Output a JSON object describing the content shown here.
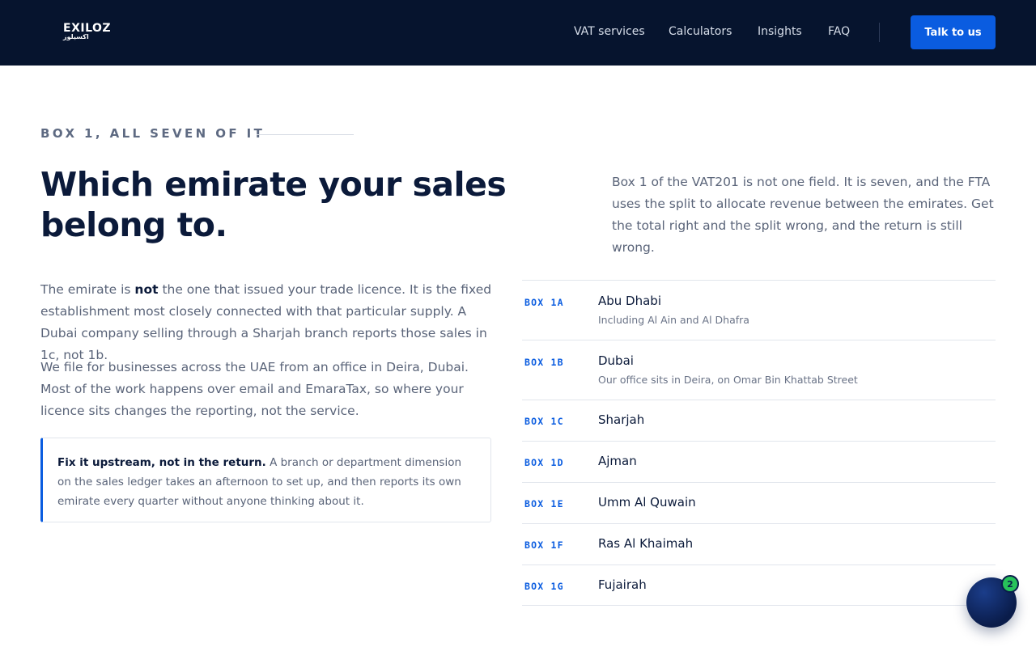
{
  "header": {
    "logo_text": "EXILOZ",
    "logo_arabic": "اكسيلوز",
    "nav": [
      {
        "label": "VAT services"
      },
      {
        "label": "Calculators"
      },
      {
        "label": "Insights"
      },
      {
        "label": "FAQ"
      }
    ],
    "cta_label": "Talk to us"
  },
  "section": {
    "eyebrow": "BOX 1, ALL SEVEN OF IT",
    "heading": "Which emirate your sales belong to.",
    "intro": "Box 1 of the VAT201 is not one field. It is seven, and the FTA uses the split to allocate revenue between the emirates. Get the total right and the split wrong, and the return is still wrong.",
    "para1_before": "The emirate is ",
    "para1_bold": "not",
    "para1_after": " the one that issued your trade licence. It is the fixed establishment most closely connected with that particular supply. A Dubai company selling through a Sharjah branch reports those sales in 1c, not 1b.",
    "para2": "We file for businesses across the UAE from an office in Deira, Dubai. Most of the work happens over email and EmaraTax, so where your licence sits changes the reporting, not the service.",
    "callout_bold": "Fix it upstream, not in the return.",
    "callout_text": " A branch or department dimension on the sales ledger takes an afternoon to set up, and then reports its own emirate every quarter without anyone thinking about it."
  },
  "boxes": [
    {
      "code": "BOX 1A",
      "name": "Abu Dhabi",
      "sub": "Including Al Ain and Al Dhafra"
    },
    {
      "code": "BOX 1B",
      "name": "Dubai",
      "sub": "Our office sits in Deira, on Omar Bin Khattab Street"
    },
    {
      "code": "BOX 1C",
      "name": "Sharjah"
    },
    {
      "code": "BOX 1D",
      "name": "Ajman"
    },
    {
      "code": "BOX 1E",
      "name": "Umm Al Quwain"
    },
    {
      "code": "BOX 1F",
      "name": "Ras Al Khaimah"
    },
    {
      "code": "BOX 1G",
      "name": "Fujairah"
    }
  ],
  "chat": {
    "badge_count": "2",
    "icon": "chat-bubble-icon"
  },
  "colors": {
    "header_bg": "#06142e",
    "accent": "#0a5ce0",
    "badge": "#27c25a"
  }
}
